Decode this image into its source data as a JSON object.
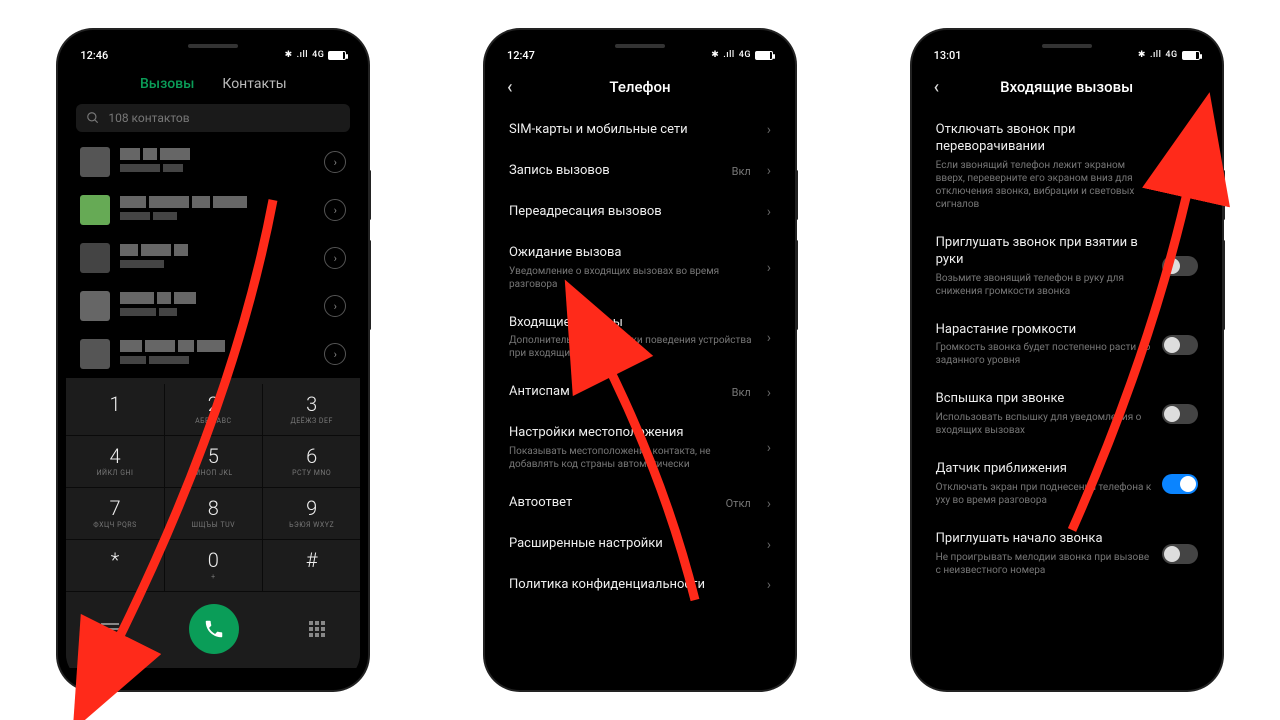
{
  "screen1": {
    "time": "12:46",
    "status_net": "4G",
    "tabs": {
      "calls": "Вызовы",
      "contacts": "Контакты"
    },
    "search_placeholder": "108 контактов",
    "dial": [
      {
        "n": "1",
        "s": ""
      },
      {
        "n": "2",
        "s": "АБВГ\nABC"
      },
      {
        "n": "3",
        "s": "ДЕЁЖЗ\nDEF"
      },
      {
        "n": "4",
        "s": "ИЙКЛ\nGHI"
      },
      {
        "n": "5",
        "s": "МНОП\nJKL"
      },
      {
        "n": "6",
        "s": "РСТУ\nMNO"
      },
      {
        "n": "7",
        "s": "ФХЦЧ\nPQRS"
      },
      {
        "n": "8",
        "s": "ШЩЪЫ\nTUV"
      },
      {
        "n": "9",
        "s": "ЬЭЮЯ\nWXYZ"
      },
      {
        "n": "*",
        "s": ""
      },
      {
        "n": "0",
        "s": "+"
      },
      {
        "n": "#",
        "s": ""
      }
    ]
  },
  "screen2": {
    "time": "12:47",
    "title": "Телефон",
    "items": [
      {
        "title": "SIM-карты и мобильные сети",
        "desc": "",
        "val": ""
      },
      {
        "title": "Запись вызовов",
        "desc": "",
        "val": "Вкл"
      },
      {
        "title": "Переадресация вызовов",
        "desc": "",
        "val": ""
      },
      {
        "title": "Ожидание вызова",
        "desc": "Уведомление о входящих вызовах во время разговора",
        "val": ""
      },
      {
        "title": "Входящие вызовы",
        "desc": "Дополнительные настройки поведения устройства при входящих вызовах",
        "val": ""
      },
      {
        "title": "Антиспам",
        "desc": "",
        "val": "Вкл"
      },
      {
        "title": "Настройки местоположения",
        "desc": "Показывать местоположение контакта, не добавлять код страны автоматически",
        "val": ""
      },
      {
        "title": "Автоответ",
        "desc": "",
        "val": "Откл"
      },
      {
        "title": "Расширенные настройки",
        "desc": "",
        "val": ""
      },
      {
        "title": "Политика конфиденциальности",
        "desc": "",
        "val": ""
      }
    ]
  },
  "screen3": {
    "time": "13:01",
    "title": "Входящие вызовы",
    "items": [
      {
        "title": "Отключать звонок при переворачивании",
        "desc": "Если звонящий телефон лежит экраном вверх, переверните его экраном вниз для отключения звонка, вибрации и световых сигналов",
        "on": true
      },
      {
        "title": "Приглушать звонок при взятии в руки",
        "desc": "Возьмите звонящий телефон в руку для снижения громкости звонка",
        "on": false
      },
      {
        "title": "Нарастание громкости",
        "desc": "Громкость звонка будет постепенно расти до заданного уровня",
        "on": false
      },
      {
        "title": "Вспышка при звонке",
        "desc": "Использовать вспышку для уведомления о входящих вызовах",
        "on": false
      },
      {
        "title": "Датчик приближения",
        "desc": "Отключать экран при поднесении телефона к уху во время разговора",
        "on": true
      },
      {
        "title": "Приглушать начало звонка",
        "desc": "Не проигрывать мелодии звонка при вызове с неизвестного номера",
        "on": false
      }
    ]
  },
  "status_icons": "✱ ₊ıll 4G"
}
